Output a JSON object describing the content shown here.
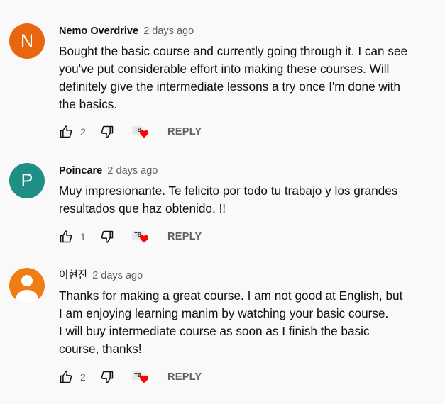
{
  "colors": {
    "avatar_1": "#e8660f",
    "avatar_2": "#1f8f85",
    "avatar_3": "#f07c14",
    "heart": "#ff0000",
    "text_secondary": "#606060",
    "background": "#f9f9f9"
  },
  "comments": [
    {
      "avatar_letter": "N",
      "author": "Nemo Overdrive",
      "time": "2 days ago",
      "text_lines": [
        "Bought the basic course and currently going through it. I can see",
        "you've put considerable effort into making these courses. Will",
        "definitely give the intermediate lessons a try once I'm done with",
        "the basics."
      ],
      "likes": "2",
      "reply_label": "REPLY",
      "creator_badge": "TB"
    },
    {
      "avatar_letter": "P",
      "author": "Poincare",
      "time": "2 days ago",
      "text_lines": [
        "Muy impresionante. Te felicito por todo tu trabajo y los grandes",
        "resultados que haz obtenido. !!"
      ],
      "likes": "1",
      "reply_label": "REPLY",
      "creator_badge": "TB"
    },
    {
      "avatar_letter": "",
      "author": "이현진",
      "time": "2 days ago",
      "text_lines": [
        "Thanks for making a great course. I am not good at English, but",
        "I am enjoying learning manim by watching your basic course.",
        "I will buy intermediate course as soon as I finish the basic",
        "course, thanks!"
      ],
      "likes": "2",
      "reply_label": "REPLY",
      "creator_badge": "TB"
    }
  ]
}
